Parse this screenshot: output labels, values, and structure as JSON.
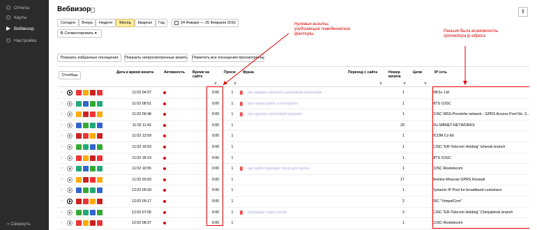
{
  "sidebar": {
    "items": [
      "Отчеты",
      "Карты",
      "Вебвизор",
      "Настройка"
    ],
    "collapse": "Свернуть"
  },
  "header": {
    "title": "Вебвизор"
  },
  "periods": [
    "Сегодня",
    "Вчера",
    "Неделя",
    "Месяц",
    "Квартал",
    "Год"
  ],
  "selected_period": "Месяц",
  "date_range": "24 Января — 25 Февраля 2016",
  "segment_button": "Сегментировать",
  "annotations": {
    "zero_visits": "Нулевые визиты, ухудшающие поведенческие факторы.",
    "ip_note": "Раньше была возможность просмотра ip-адреса"
  },
  "actions": [
    "Показать избранные посещения",
    "Показать непросмотренные визиты",
    "Пометить все посещения просмотренными"
  ],
  "columns_button": "Столбцы",
  "columns": {
    "datetime": "Дата и время визита",
    "activity": "Активность",
    "duration": "Время на сайте",
    "views": "Просм",
    "phrase": "Фраза",
    "transition": "Переход с сайта",
    "page_number": "Номер визита",
    "goals": "Цели",
    "ip_network": "IP сеть"
  },
  "rows": [
    {
      "time": "11:02 04:07",
      "duration": "0:00",
      "views": "1",
      "phrase": "как придать мягкость шелковым мешочкам",
      "number": "1",
      "ip": "BIKS+ Ltd",
      "dark": true
    },
    {
      "time": "11:02 08:51",
      "duration": "0:00",
      "views": "1",
      "phrase": "все ткани купить в интернете",
      "number": "1",
      "ip": "MTS OJSC",
      "dark": false
    },
    {
      "time": "11:02 09:48",
      "duration": "0:00",
      "views": "1",
      "phrase": "как сделать шелковый мешочек",
      "number": "1",
      "ip": "OJSC MSS-Povolzhe network - GPRS Access Pool No. 3...",
      "dark": false
    },
    {
      "time": "11:02 11:41",
      "duration": "0:00",
      "views": "1",
      "phrase": "",
      "number": "29",
      "ip": "RU-SIBNET-NETWORKS",
      "dark": false
    },
    {
      "time": "11:02 13:59",
      "duration": "0:00",
      "views": "1",
      "phrase": "",
      "number": "1",
      "ip": "2COM Co ltd",
      "dark": false
    },
    {
      "time": "11:02 16:53",
      "duration": "0:00",
      "views": "1",
      "phrase": "",
      "number": "1",
      "ip": "CJSC \"ER-Telecom Holding\" Izhevsk branch",
      "dark": false
    },
    {
      "time": "11:02 18:19",
      "duration": "0:00",
      "views": "1",
      "phrase": "",
      "number": "1",
      "ip": "MTS OJSC",
      "dark": false
    },
    {
      "time": "11:02 19:55",
      "duration": "0:00",
      "views": "1",
      "phrase": "где найти хорошие ткани для шитья",
      "number": "1",
      "ip": "OJSC Rostelecom",
      "dark": false
    },
    {
      "time": "11:02 20:03",
      "duration": "0:00",
      "views": "1",
      "phrase": "",
      "number": "17",
      "ip": "Beeline-Moscow GPRS Firewall",
      "dark": false
    },
    {
      "time": "12:02 00:18",
      "duration": "0:00",
      "views": "1",
      "phrase": "",
      "number": "1",
      "ip": "Dynamic IP Pool for broadband customers",
      "dark": false
    },
    {
      "time": "12:02 05:17",
      "duration": "0:00",
      "views": "1",
      "phrase": "",
      "number": "2",
      "ip": "JSC \"VimpelCom\"",
      "dark": true
    },
    {
      "time": "12:02 07:06",
      "duration": "0:00",
      "views": "1",
      "phrase": "шелковые ткани оптом",
      "number": "2",
      "ip": "CJSC \"ER-Telecom Holding\" Chelyabinsk branch",
      "dark": false
    },
    {
      "time": "12:02 08:37",
      "duration": "0:00",
      "views": "1",
      "phrase": "",
      "number": "1",
      "ip": "OJSC Rostelecom",
      "dark": false
    }
  ],
  "browser_icon_colors": [
    "#e33",
    "#2a7",
    "#fa0",
    "#36c",
    "#c22",
    "#3a3"
  ]
}
